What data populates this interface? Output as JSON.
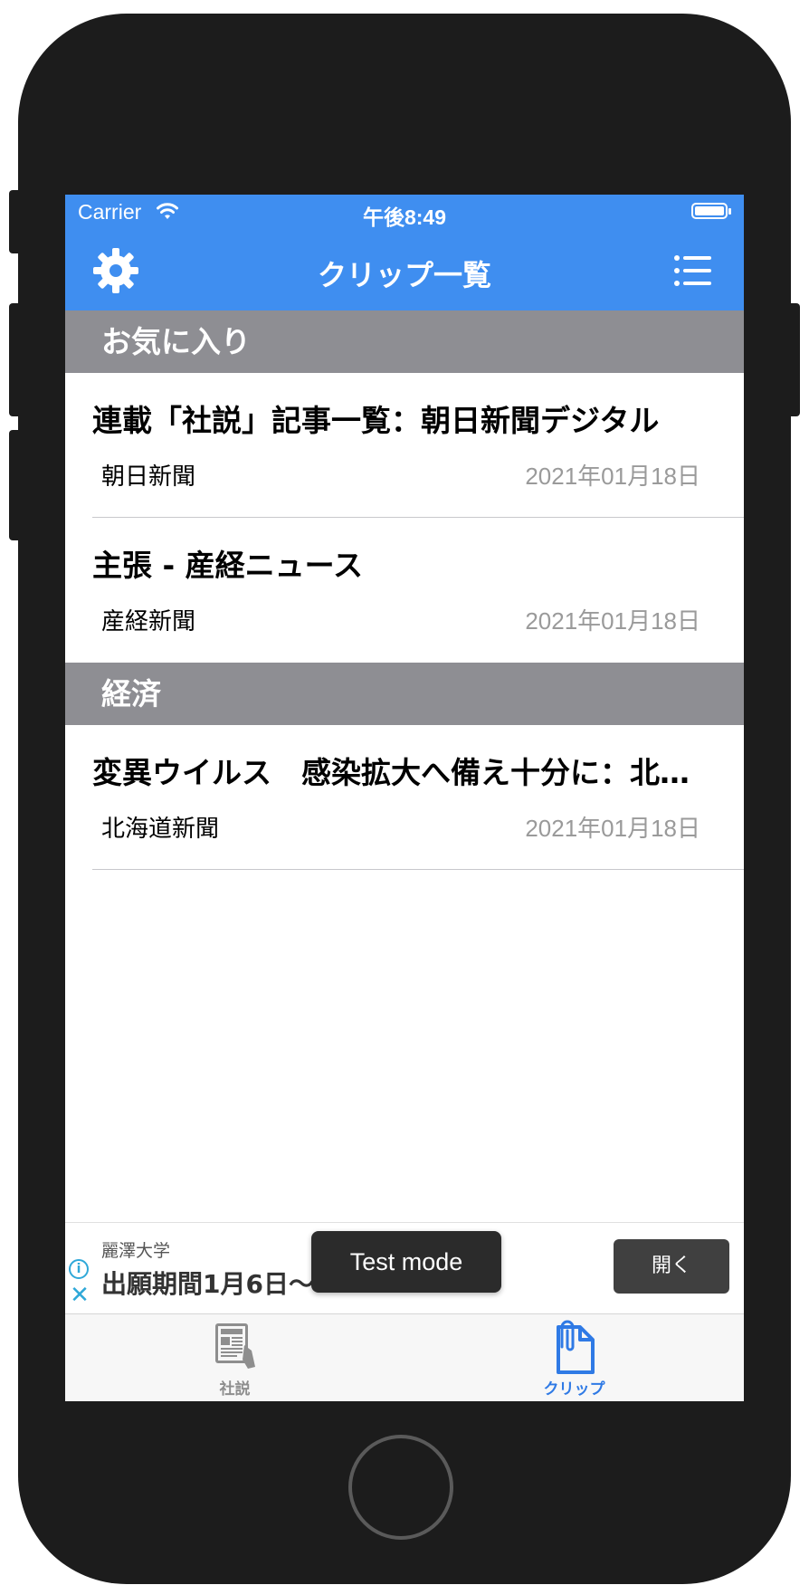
{
  "status_bar": {
    "carrier": "Carrier",
    "time": "午後8:49"
  },
  "nav_bar": {
    "title": "クリップ一覧"
  },
  "sections": [
    {
      "header": "お気に入り",
      "items": [
        {
          "title": "連載「社説」記事一覧：朝日新聞デジタル",
          "source": "朝日新聞",
          "date": "2021年01月18日"
        },
        {
          "title": "主張 - 産経ニュース",
          "source": "産経新聞",
          "date": "2021年01月18日"
        }
      ]
    },
    {
      "header": "経済",
      "items": [
        {
          "title": "変異ウイルス　感染拡大へ備え十分に：北…",
          "source": "北海道新聞",
          "date": "2021年01月18日"
        }
      ]
    }
  ],
  "ad": {
    "sponsor": "麗澤大学",
    "headline": "出願期間1月6日〜",
    "open_label": "開く",
    "toast": "Test mode",
    "info_glyph": "i",
    "close_glyph": "✕"
  },
  "tab_bar": {
    "tabs": [
      {
        "label": "社説",
        "icon": "newspaper-icon",
        "selected": false
      },
      {
        "label": "クリップ",
        "icon": "paperclip-document-icon",
        "selected": true
      }
    ]
  },
  "colors": {
    "accent": "#3f8ef0",
    "section_header": "#8e8e93",
    "date_text": "#9a9a9a",
    "tab_selected": "#2f7ae5",
    "tab_unselected": "#8e8e8e"
  }
}
